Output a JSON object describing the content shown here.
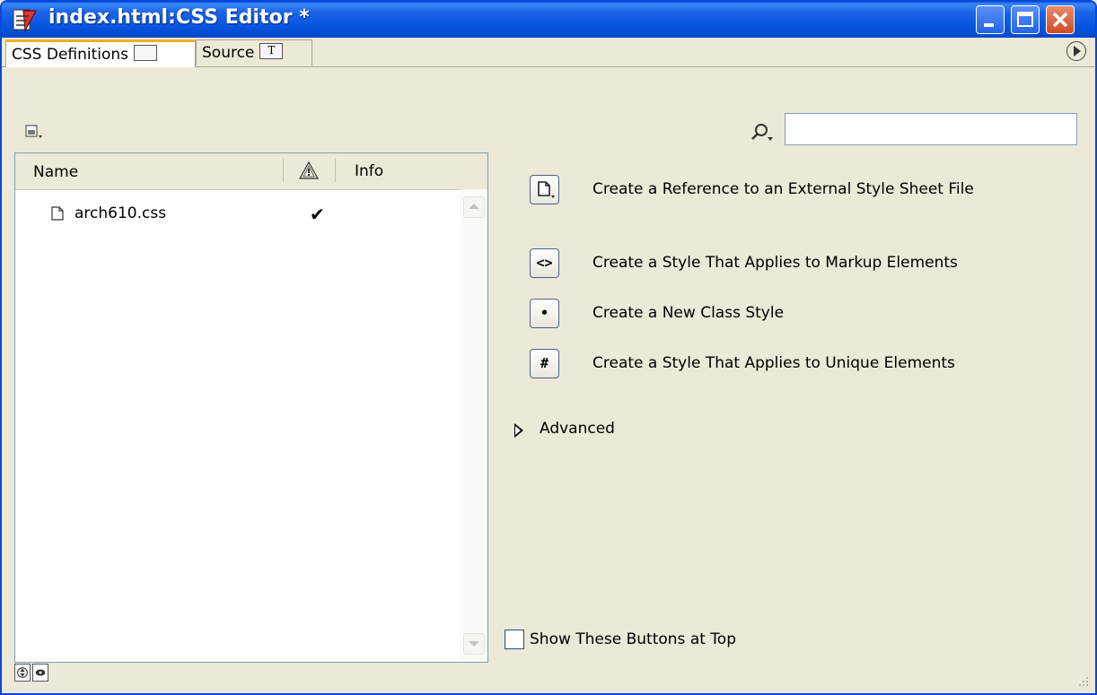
{
  "window": {
    "title": "index.html:CSS Editor *"
  },
  "tabs": [
    {
      "label": "CSS Definitions",
      "active": true
    },
    {
      "label": "Source",
      "active": false
    }
  ],
  "search": {
    "value": "",
    "placeholder": ""
  },
  "list": {
    "columns": {
      "name": "Name",
      "info": "Info"
    },
    "rows": [
      {
        "name": "arch610.css",
        "checked": true,
        "check_glyph": "✔"
      }
    ]
  },
  "actions": [
    {
      "glyph": "",
      "label": "Create a Reference to an External Style Sheet File"
    },
    {
      "glyph": "<>",
      "label": "Create a Style That Applies to Markup Elements"
    },
    {
      "glyph": "•",
      "label": "Create a New Class Style"
    },
    {
      "glyph": "#",
      "label": "Create a Style That Applies to Unique Elements"
    }
  ],
  "advanced": {
    "label": "Advanced",
    "expanded": false
  },
  "show_buttons_top": {
    "label": "Show These Buttons at Top",
    "checked": false
  },
  "colors": {
    "titlebar": "#0654de",
    "tab_accent": "#f3ad2c",
    "panel_bg": "#ece9d8"
  }
}
